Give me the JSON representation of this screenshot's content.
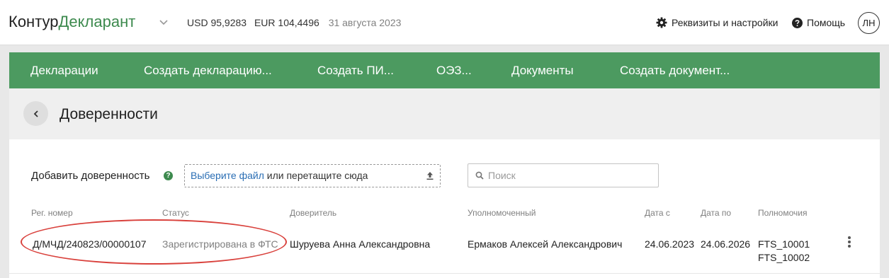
{
  "header": {
    "logo_brand": "Контур",
    "logo_product": "Декларант",
    "usd": "USD 95,9283",
    "eur": "EUR 104,4496",
    "date": "31 августа 2023",
    "settings_link": "Реквизиты и настройки",
    "help_link": "Помощь",
    "avatar_initials": "ЛН"
  },
  "nav": {
    "items": [
      {
        "label": "Декларации"
      },
      {
        "label": "Создать декларацию..."
      },
      {
        "label": "Создать ПИ..."
      },
      {
        "label": "ОЭЗ..."
      },
      {
        "label": "Документы"
      },
      {
        "label": "Создать документ..."
      }
    ]
  },
  "page": {
    "title": "Доверенности"
  },
  "upload": {
    "label": "Добавить доверенность",
    "help": "?",
    "pick_file": "Выберите файл",
    "drop_text": " или перетащите сюда"
  },
  "search": {
    "placeholder": "Поиск"
  },
  "table": {
    "columns": [
      "Рег. номер",
      "Статус",
      "Доверитель",
      "Уполномоченный",
      "Дата с",
      "Дата по",
      "Полномочия"
    ],
    "rows": [
      {
        "reg_number": "Д/МЧД/240823/00000107",
        "status": "Зарегистрирована в ФТС",
        "principal": "Шуруева Анна Александровна",
        "authorized": "Ермаков Алексей Александрович",
        "date_from": "24.06.2023",
        "date_to": "24.06.2026",
        "powers": [
          "FTS_10001",
          "FTS_10002"
        ]
      }
    ]
  },
  "colors": {
    "brand_green": "#4c9a60",
    "link_blue": "#2a6eb4",
    "annotation_red": "#d9413c"
  },
  "icons": [
    "chevron-down-icon",
    "gear-icon",
    "help-circle-icon",
    "chevron-left-icon",
    "upload-icon",
    "search-icon",
    "kebab-menu-icon"
  ]
}
